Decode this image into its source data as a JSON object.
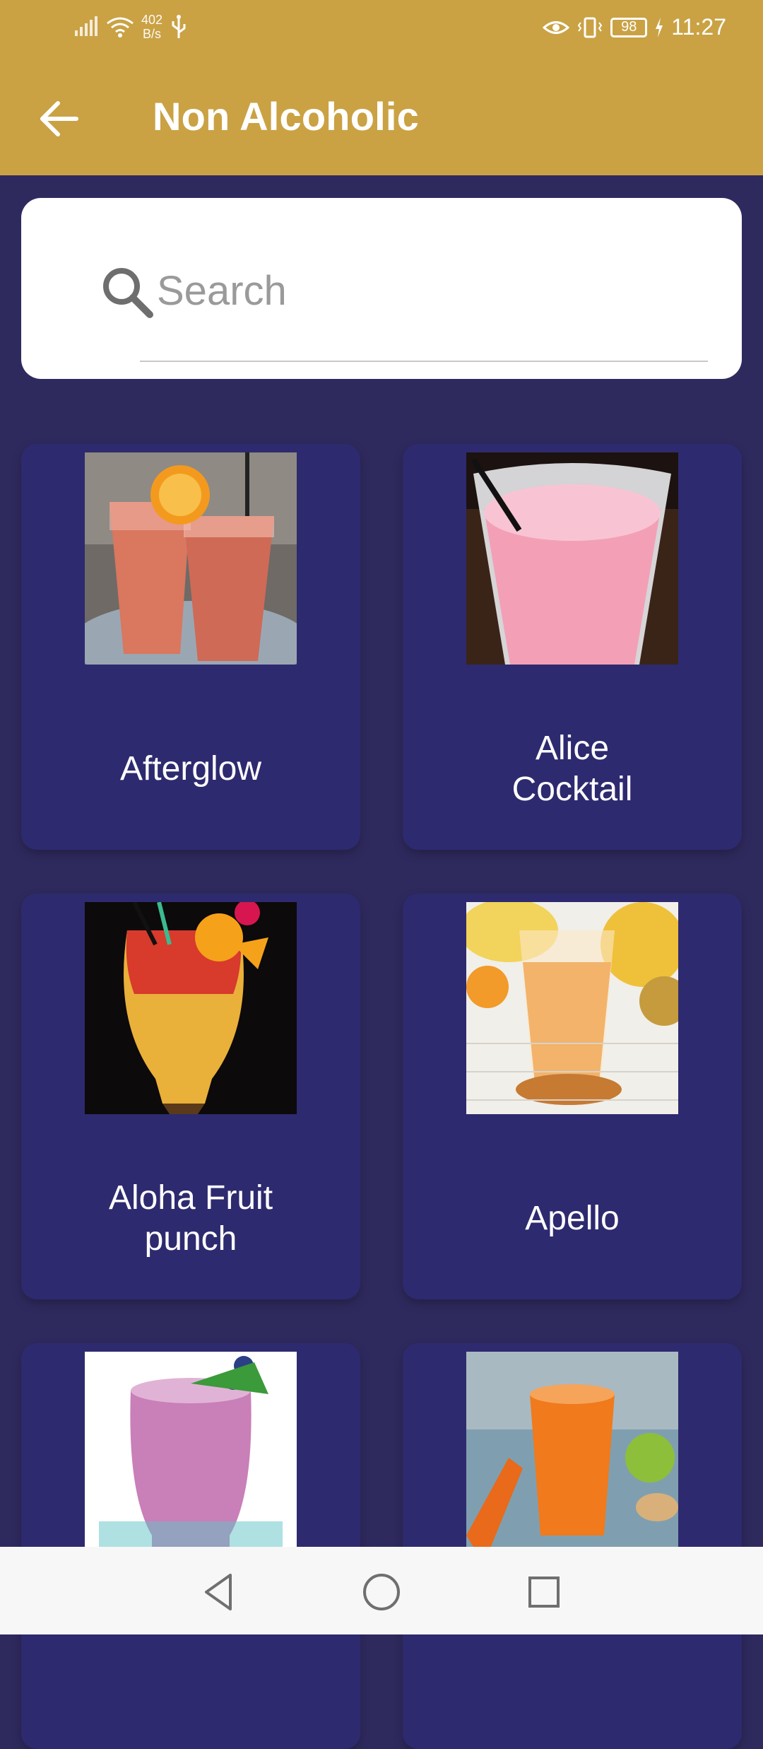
{
  "status_bar": {
    "net_speed_value": "402",
    "net_speed_unit": "B/s",
    "battery_level": "98",
    "time": "11:27",
    "icons": [
      "signal-icon",
      "wifi-icon",
      "usb-icon",
      "eye-icon",
      "vibrate-icon",
      "battery-icon",
      "charging-icon"
    ]
  },
  "app_bar": {
    "back_icon": "arrow-left-icon",
    "title": "Non Alcoholic"
  },
  "search": {
    "placeholder": "Search",
    "value": "",
    "icon": "search-icon"
  },
  "drinks": [
    {
      "name": "Afterglow"
    },
    {
      "name": "Alice\nCocktail"
    },
    {
      "name": "Aloha Fruit\npunch"
    },
    {
      "name": "Apello"
    },
    {
      "name": ""
    },
    {
      "name": ""
    }
  ],
  "nav_bar": {
    "icons": [
      "back-triangle-icon",
      "home-circle-icon",
      "recents-square-icon"
    ]
  },
  "colors": {
    "app_bar": "#caa244",
    "background": "#2f2a5e",
    "card": "#2e2a6f"
  }
}
